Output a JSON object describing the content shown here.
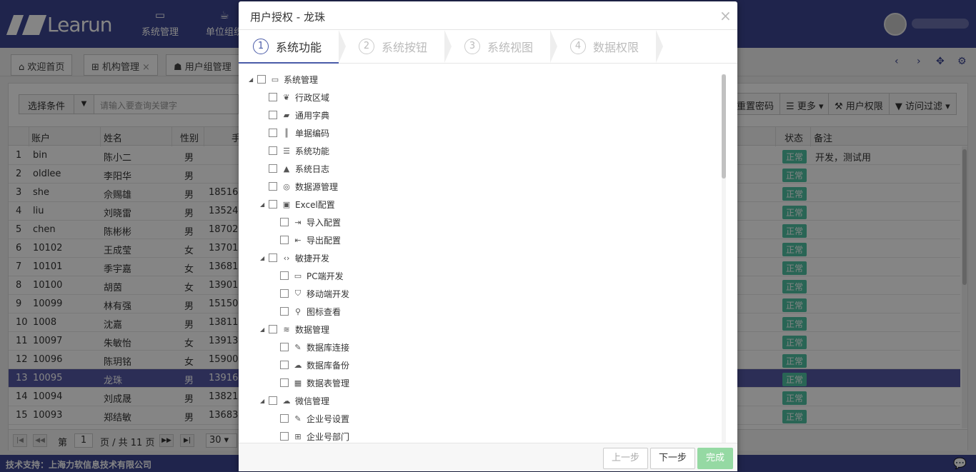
{
  "app": {
    "logo_text": "Learun"
  },
  "topnav": [
    {
      "label": "系统管理",
      "icon": "monitor-icon"
    },
    {
      "label": "单位组织",
      "icon": "coffee-icon"
    }
  ],
  "tabs": [
    {
      "label": "欢迎首页",
      "icon": "home-icon"
    },
    {
      "label": "机构管理",
      "icon": "sitemap-icon"
    },
    {
      "label": "用户组管理",
      "icon": "users-icon"
    }
  ],
  "search": {
    "condition_label": "选择条件",
    "placeholder": "请输入要查询关键字"
  },
  "toolbar": {
    "reset_password": "重置密码",
    "more": "更多",
    "user_permission": "用户权限",
    "access_filter": "访问过滤"
  },
  "grid": {
    "columns": [
      "账户",
      "姓名",
      "性别",
      "手",
      "状态",
      "备注"
    ],
    "rows": [
      {
        "n": "1",
        "account": "bin",
        "name": "陈小二",
        "gender": "男",
        "phone": "",
        "status": "正常",
        "note": "开发，测试用"
      },
      {
        "n": "2",
        "account": "oldlee",
        "name": "李阳华",
        "gender": "男",
        "phone": "",
        "status": "正常",
        "note": ""
      },
      {
        "n": "3",
        "account": "she",
        "name": "佘赐雄",
        "gender": "男",
        "phone": "18516",
        "status": "正常",
        "note": ""
      },
      {
        "n": "4",
        "account": "liu",
        "name": "刘晓雷",
        "gender": "男",
        "phone": "13524",
        "status": "正常",
        "note": ""
      },
      {
        "n": "5",
        "account": "chen",
        "name": "陈彬彬",
        "gender": "男",
        "phone": "18702",
        "status": "正常",
        "note": ""
      },
      {
        "n": "6",
        "account": "10102",
        "name": "王成莹",
        "gender": "女",
        "phone": "13701",
        "status": "正常",
        "note": ""
      },
      {
        "n": "7",
        "account": "10101",
        "name": "季宇嘉",
        "gender": "女",
        "phone": "13681",
        "status": "正常",
        "note": ""
      },
      {
        "n": "8",
        "account": "10100",
        "name": "胡茵",
        "gender": "女",
        "phone": "13901",
        "status": "正常",
        "note": ""
      },
      {
        "n": "9",
        "account": "10099",
        "name": "林有强",
        "gender": "男",
        "phone": "15150",
        "status": "正常",
        "note": ""
      },
      {
        "n": "10",
        "account": "1008",
        "name": "沈嘉",
        "gender": "男",
        "phone": "13811",
        "status": "正常",
        "note": ""
      },
      {
        "n": "11",
        "account": "10097",
        "name": "朱敏怡",
        "gender": "女",
        "phone": "13913",
        "status": "正常",
        "note": ""
      },
      {
        "n": "12",
        "account": "10096",
        "name": "陈玥铭",
        "gender": "女",
        "phone": "15900",
        "status": "正常",
        "note": ""
      },
      {
        "n": "13",
        "account": "10095",
        "name": "龙珠",
        "gender": "男",
        "phone": "13916",
        "status": "正常",
        "note": ""
      },
      {
        "n": "14",
        "account": "10094",
        "name": "刘成晟",
        "gender": "男",
        "phone": "13821",
        "status": "正常",
        "note": ""
      },
      {
        "n": "15",
        "account": "10093",
        "name": "郑结敏",
        "gender": "男",
        "phone": "13683",
        "status": "正常",
        "note": ""
      }
    ],
    "selected_index": 12
  },
  "pager": {
    "page_prefix": "第",
    "page": "1",
    "page_suffix": "页 / 共 11 页",
    "page_size": "30"
  },
  "footer": {
    "text": "技术支持：上海力软信息技术有限公司"
  },
  "modal": {
    "title": "用户授权 - 龙珠",
    "close": "×",
    "steps": [
      {
        "num": "1",
        "label": "系统功能",
        "active": true
      },
      {
        "num": "2",
        "label": "系统按钮",
        "active": false
      },
      {
        "num": "3",
        "label": "系统视图",
        "active": false
      },
      {
        "num": "4",
        "label": "数据权限",
        "active": false
      }
    ],
    "tree": [
      {
        "label": "系统管理",
        "level": 0,
        "expanded": true,
        "icon": "monitor-icon"
      },
      {
        "label": "行政区域",
        "level": 1,
        "icon": "leaf-icon"
      },
      {
        "label": "通用字典",
        "level": 1,
        "icon": "book-icon"
      },
      {
        "label": "单据编码",
        "level": 1,
        "icon": "barcode-icon"
      },
      {
        "label": "系统功能",
        "level": 1,
        "icon": "list-icon"
      },
      {
        "label": "系统日志",
        "level": 1,
        "icon": "warning-icon"
      },
      {
        "label": "数据源管理",
        "level": 1,
        "icon": "target-icon"
      },
      {
        "label": "Excel配置",
        "level": 1,
        "expanded": true,
        "icon": "excel-icon"
      },
      {
        "label": "导入配置",
        "level": 2,
        "icon": "sign-in-icon"
      },
      {
        "label": "导出配置",
        "level": 2,
        "icon": "sign-out-icon"
      },
      {
        "label": "敏捷开发",
        "level": 1,
        "expanded": true,
        "icon": "code-icon"
      },
      {
        "label": "PC端开发",
        "level": 2,
        "icon": "monitor-icon"
      },
      {
        "label": "移动端开发",
        "level": 2,
        "icon": "html5-icon"
      },
      {
        "label": "图标查看",
        "level": 2,
        "icon": "search-icon"
      },
      {
        "label": "数据管理",
        "level": 1,
        "expanded": true,
        "icon": "database-icon"
      },
      {
        "label": "数据库连接",
        "level": 2,
        "icon": "plug-icon"
      },
      {
        "label": "数据库备份",
        "level": 2,
        "icon": "cloud-upload-icon"
      },
      {
        "label": "数据表管理",
        "level": 2,
        "icon": "table-icon"
      },
      {
        "label": "微信管理",
        "level": 1,
        "expanded": true,
        "icon": "wechat-icon"
      },
      {
        "label": "企业号设置",
        "level": 2,
        "icon": "plug-icon"
      },
      {
        "label": "企业号部门",
        "level": 2,
        "icon": "sitemap-icon"
      }
    ],
    "buttons": {
      "prev": "上一步",
      "next": "下一步",
      "finish": "完成"
    }
  }
}
